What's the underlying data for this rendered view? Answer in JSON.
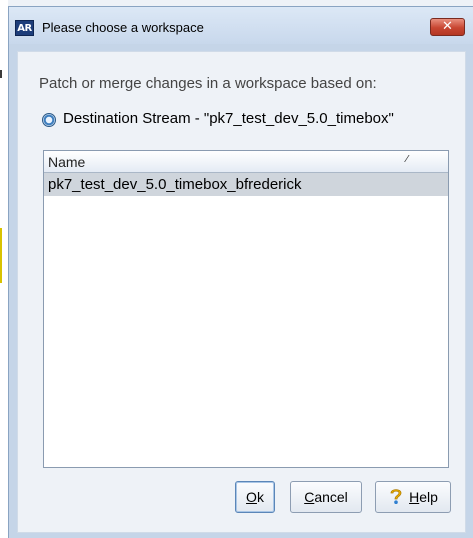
{
  "window": {
    "app_icon_text": "AR",
    "title": "Please choose a workspace",
    "close_glyph": "✕"
  },
  "dialog": {
    "prompt": "Patch or merge changes in a workspace based on:",
    "radio_label": "Destination Stream - \"pk7_test_dev_5.0_timebox\"",
    "radio_selected": true
  },
  "list": {
    "columns": [
      {
        "label": "Name",
        "sort_icon": "sort-indicator-icon"
      }
    ],
    "rows": [
      {
        "name": "pk7_test_dev_5.0_timebox_bfrederick",
        "selected": true
      }
    ]
  },
  "buttons": {
    "ok": {
      "mnemonic": "O",
      "rest": "k"
    },
    "cancel": {
      "mnemonic": "C",
      "rest": "ancel"
    },
    "help": {
      "mnemonic": "H",
      "rest": "elp",
      "icon": "help-icon"
    }
  },
  "colors": {
    "selection": "#cfd5dc",
    "close_button": "#c84632",
    "dialog_frame": "#c5d5e8"
  }
}
